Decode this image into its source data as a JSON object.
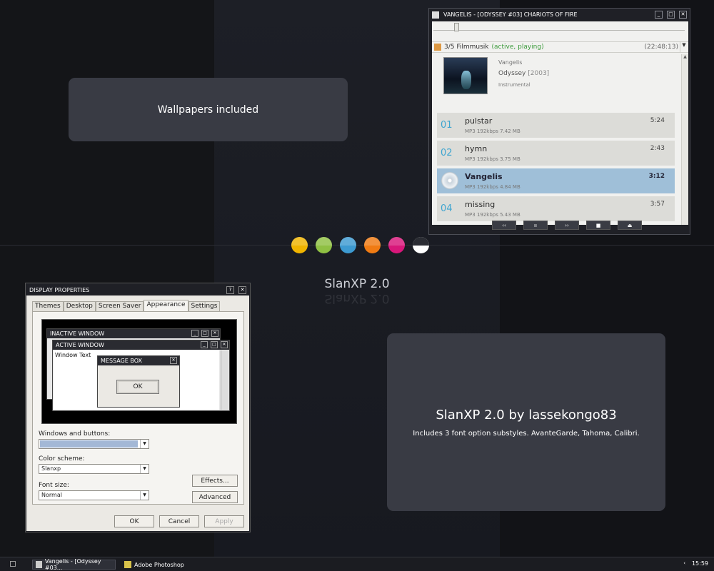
{
  "desktop": {
    "card1_text": "Wallpapers included",
    "center_title": "SlanXP 2.0",
    "card2_title": "SlanXP 2.0 by lassekongo83",
    "card2_subtitle": "Includes 3 font option substyles. AvanteGarde, Tahoma, Calibri.",
    "colors": [
      "#f0b400",
      "#8fc043",
      "#3d9ad1",
      "#f07b13",
      "#d8177a",
      "#ffffff"
    ]
  },
  "player": {
    "title": "VANGELIS - [ODYSSEY #03] CHARIOTS OF FIRE",
    "playlist": "3/5 Filmmusik",
    "playlist_state": "(active, playing)",
    "playlist_time": "(22:48:13)",
    "artist": "Vangelis",
    "album": "Odyssey",
    "album_year": "[2003]",
    "genre": "Instrumental",
    "tracks": [
      {
        "num": "01",
        "name": "pulstar",
        "info": "MP3  192kbps  7.42 MB",
        "duration": "5:24"
      },
      {
        "num": "02",
        "name": "hymn",
        "info": "MP3  192kbps  3.75 MB",
        "duration": "2:43"
      },
      {
        "num": "",
        "name": "Vangelis",
        "info": "MP3  192kbps  4.84 MB",
        "duration": "3:12"
      },
      {
        "num": "04",
        "name": "missing",
        "info": "MP3  192kbps  5.43 MB",
        "duration": "3:57"
      }
    ],
    "controls": [
      "‹‹",
      "ıı",
      "››",
      "■",
      "⏏"
    ]
  },
  "display_properties": {
    "title": "DISPLAY PROPERTIES",
    "help": "?",
    "close": "✕",
    "tabs": [
      "Themes",
      "Desktop",
      "Screen Saver",
      "Appearance",
      "Settings"
    ],
    "inactive_window": "INACTIVE WINDOW",
    "active_window": "ACTIVE WINDOW",
    "window_text": "Window Text",
    "message_box": "MESSAGE BOX",
    "message_ok": "OK",
    "windows_buttons_label": "Windows and buttons:",
    "windows_buttons_value": "",
    "color_scheme_label": "Color scheme:",
    "color_scheme_value": "Slanxp",
    "font_size_label": "Font size:",
    "font_size_value": "Normal",
    "effects": "Effects...",
    "advanced": "Advanced",
    "ok": "OK",
    "cancel": "Cancel",
    "apply": "Apply"
  },
  "taskbar": {
    "tasks": [
      "Vangelis - [Odyssey #03...",
      "Adobe Photoshop"
    ],
    "tray_arrow": "‹",
    "clock": "15:59"
  }
}
